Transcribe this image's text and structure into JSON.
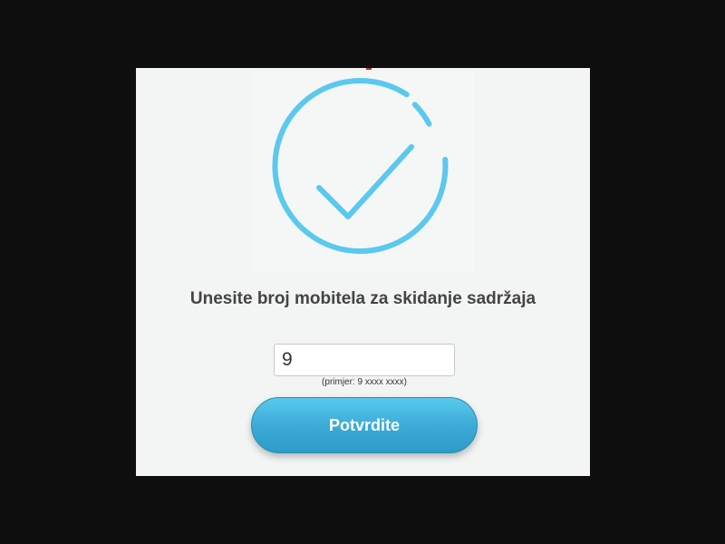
{
  "modal": {
    "title": "Unesite broj mobitela za skidanje sadržaja",
    "phone_input": {
      "value": "9",
      "placeholder": ""
    },
    "example_text": "(primjer: 9 xxxx xxxx)",
    "confirm_label": "Potvrdite",
    "check_icon": "circle-check-icon",
    "colors": {
      "accent": "#5bc8ef",
      "button_top": "#58c9ee",
      "button_bottom": "#2e9bc8",
      "background": "#f3f5f5",
      "overlay": "#0e0e0e"
    }
  }
}
